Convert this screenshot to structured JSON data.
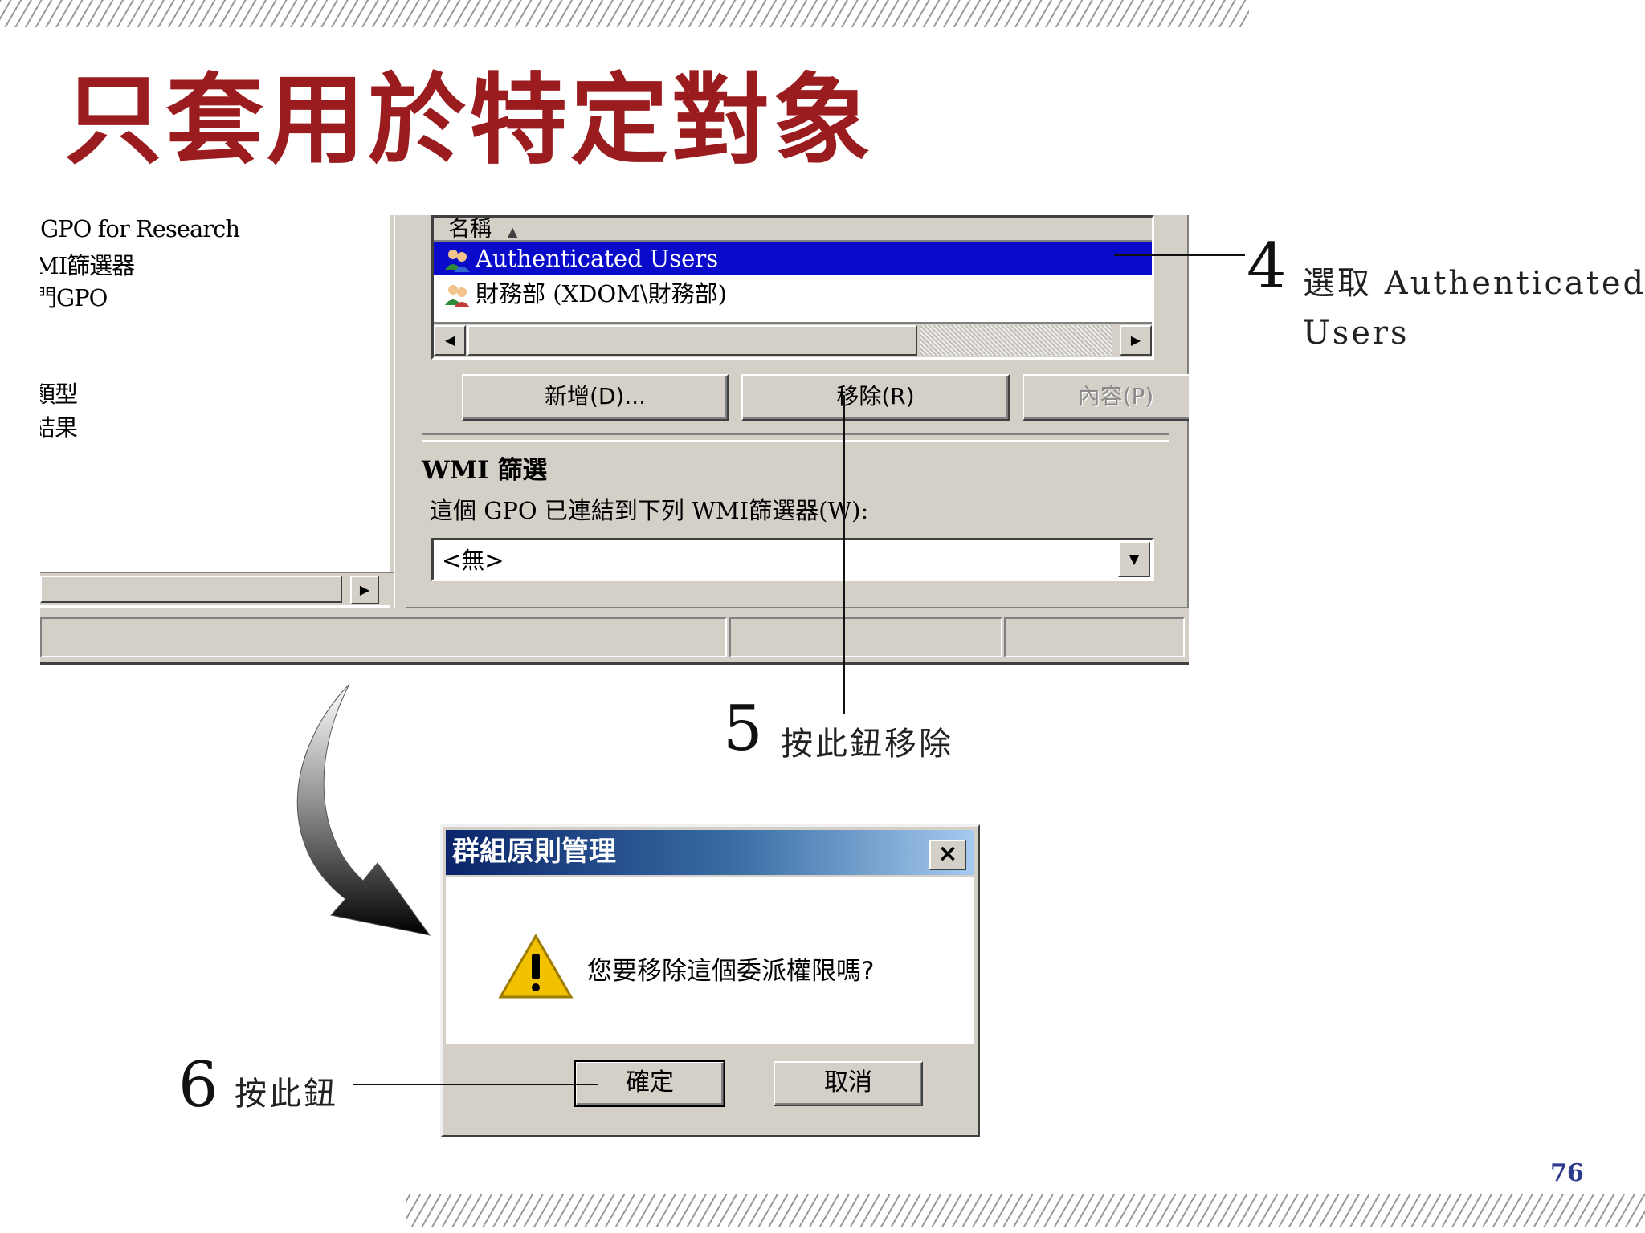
{
  "slide": {
    "title": "只套用於特定對象",
    "page_number": "76"
  },
  "console": {
    "tree_items": [
      "GPO for Research",
      "MI篩選器",
      "門GPO",
      "類型",
      "結果"
    ],
    "delegation_list": {
      "column_header": "名稱",
      "rows": [
        {
          "label": "Authenticated Users",
          "selected": true
        },
        {
          "label": "財務部 (XDOM\\財務部)",
          "selected": false
        }
      ]
    },
    "buttons": {
      "add": "新增(D)...",
      "remove": "移除(R)",
      "properties": "內容(P)"
    },
    "wmi": {
      "heading": "WMI 篩選",
      "label": "這個 GPO 已連結到下列 WMI篩選器(W):",
      "value": "<無>"
    }
  },
  "callouts": {
    "step4": {
      "number": "4",
      "text_line1": "選取 Authenticated",
      "text_line2": "Users"
    },
    "step5": {
      "number": "5",
      "text": "按此鈕移除"
    },
    "step6": {
      "number": "6",
      "text": "按此鈕"
    }
  },
  "dialog": {
    "title": "群組原則管理",
    "message": "您要移除這個委派權限嗎?",
    "ok_label": "確定",
    "cancel_label": "取消",
    "close_glyph": "×"
  },
  "colors": {
    "title_red": "#9b1c1f",
    "selection_blue": "#0a0acb",
    "page_number_blue": "#2b3a8c",
    "window_gray": "#d4d0c8"
  },
  "icons": [
    "user-group-icon",
    "warning-icon",
    "close-icon",
    "scroll-left-icon",
    "scroll-right-icon",
    "dropdown-arrow-icon",
    "curved-arrow-icon"
  ]
}
